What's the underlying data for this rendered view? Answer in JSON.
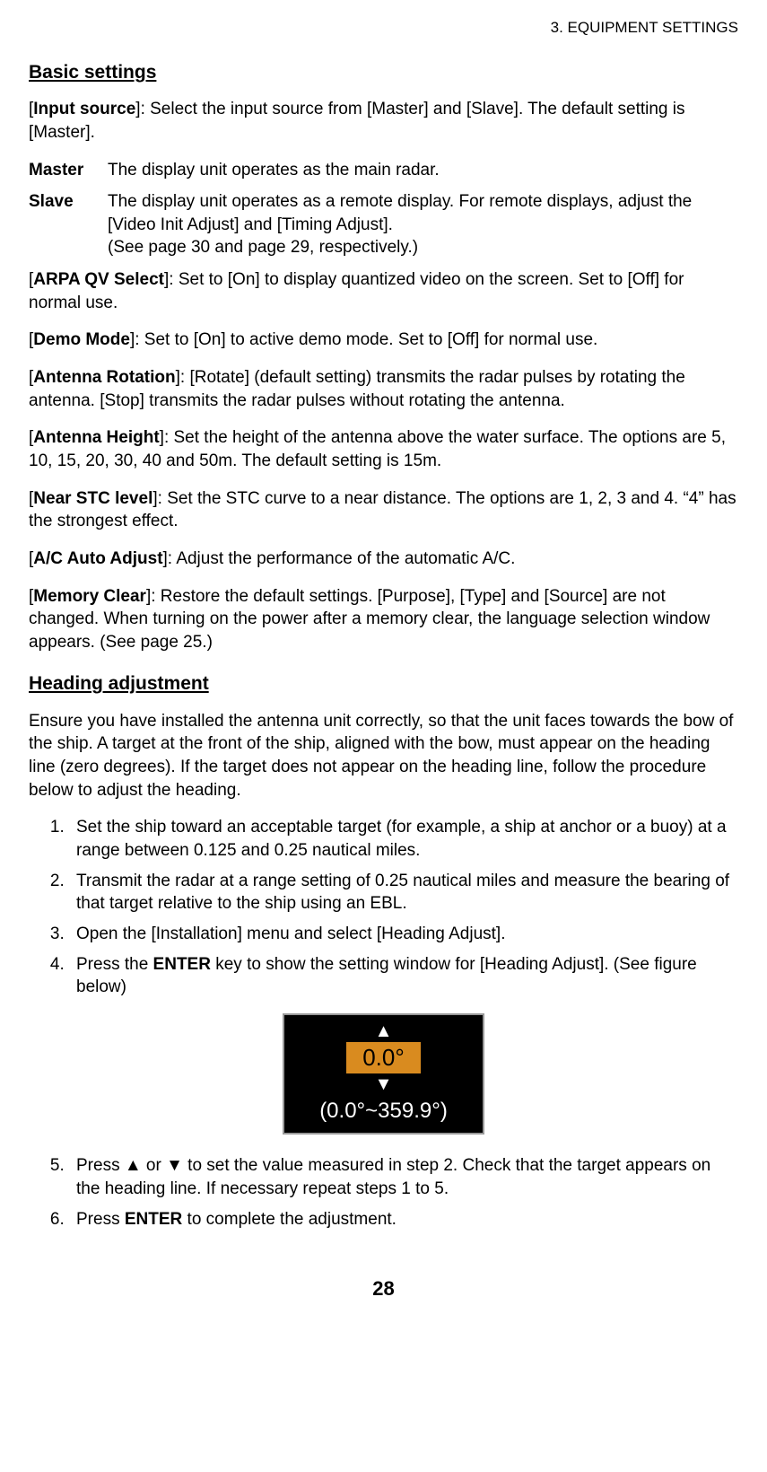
{
  "header": {
    "chapter": "3.  EQUIPMENT SETTINGS"
  },
  "basic": {
    "heading": "Basic settings",
    "input_source": {
      "label": "Input source",
      "text": "]: Select the input source from [Master] and [Slave]. The default setting is [Master]."
    },
    "master": {
      "term": "Master",
      "desc": "The display unit operates as the main radar."
    },
    "slave": {
      "term": "Slave",
      "desc_l1": "The display unit operates as a remote display. For remote displays, adjust the [Video Init Adjust] and [Timing Adjust].",
      "desc_l2": "(See page 30 and page 29, respectively.)"
    },
    "arpa": {
      "label": "ARPA QV Select",
      "text": "]: Set to [On] to display quantized video on the screen. Set to [Off] for normal use."
    },
    "demo": {
      "label": "Demo Mode",
      "text": "]: Set to [On] to active demo mode. Set to [Off] for normal use."
    },
    "rotation": {
      "label": "Antenna Rotation",
      "text": "]: [Rotate] (default setting) transmits the radar pulses by rotating the antenna. [Stop] transmits the radar pulses without rotating the antenna."
    },
    "height": {
      "label": "Antenna Height",
      "text": "]: Set the height of the antenna above the water surface. The options are 5, 10, 15, 20, 30, 40 and 50m. The default setting is 15m."
    },
    "stc": {
      "label": "Near STC level",
      "text": "]: Set the STC curve to a near distance. The options are 1, 2, 3 and 4. “4” has the strongest effect."
    },
    "ac": {
      "label": "A/C Auto Adjust",
      "text": "]: Adjust the performance of the automatic A/C."
    },
    "memory": {
      "label": "Memory Clear",
      "text": "]: Restore the default settings. [Purpose], [Type] and [Source] are not changed. When turning on the power after a memory clear, the language selection window appears. (See page 25.)"
    }
  },
  "heading_adj": {
    "heading": "Heading adjustment",
    "intro": "Ensure you have installed the antenna unit correctly, so that the unit faces towards the bow of the ship. A target at the front of the ship, aligned with the bow, must appear on the heading line (zero degrees). If the target does not appear on the heading line, follow the procedure below to adjust the heading.",
    "steps": {
      "s1": "Set the ship toward an acceptable target (for example, a ship at anchor or a buoy) at a range between 0.125 and 0.25 nautical miles.",
      "s2": "Transmit the radar at a range setting of 0.25 nautical miles and measure the bearing of that target relative to the ship using an EBL.",
      "s3": "Open the [Installation] menu and select [Heading Adjust].",
      "s4_a": "Press the ",
      "s4_key": "ENTER",
      "s4_b": " key to show the setting window for [Heading Adjust]. (See figure below)",
      "s5": "Press ▲ or ▼ to set the value measured in step 2. Check that the target appears on the heading line. If necessary repeat steps 1 to 5.",
      "s6_a": "Press ",
      "s6_key": "ENTER",
      "s6_b": " to complete the adjustment."
    }
  },
  "figure": {
    "value": "0.0°",
    "range": "(0.0°~359.9°)"
  },
  "page_number": "28"
}
